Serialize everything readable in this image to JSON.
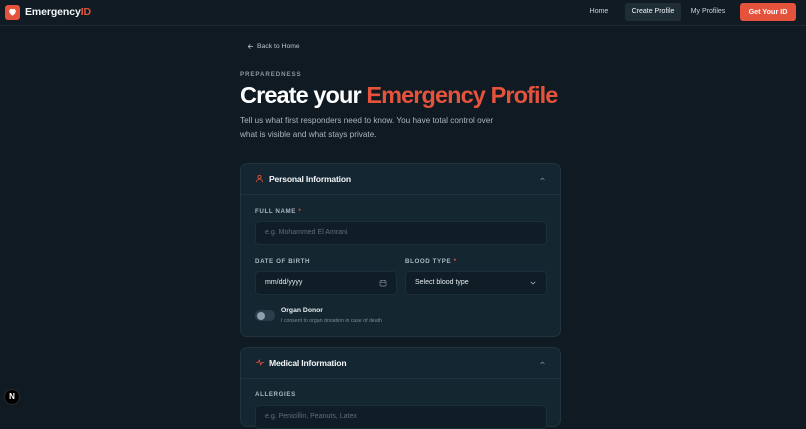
{
  "brand": {
    "name_prefix": "Emergency",
    "name_suffix": "ID"
  },
  "nav": {
    "home": "Home",
    "create_profile": "Create Profile",
    "my_profiles": "My Profiles",
    "cta": "Get Your ID"
  },
  "back_link": "Back to Home",
  "page": {
    "eyebrow": "PREPAREDNESS",
    "title_prefix": "Create your ",
    "title_accent": "Emergency Profile",
    "subtitle": "Tell us what first responders need to know. You have total control over what is visible and what stays private."
  },
  "personal": {
    "title": "Personal Information",
    "full_name_label": "FULL NAME",
    "full_name_placeholder": "e.g. Mohammed El Amrani",
    "dob_label": "DATE OF BIRTH",
    "dob_value": "mm/dd/yyyy",
    "blood_label": "BLOOD TYPE",
    "blood_value": "Select blood type",
    "required_mark": "*",
    "donor_title": "Organ Donor",
    "donor_desc": "I consent to organ donation in case of death",
    "donor_enabled": false
  },
  "medical": {
    "title": "Medical Information",
    "allergies_label": "ALLERGIES",
    "allergies_placeholder": "e.g. Penicillin, Peanuts, Latex"
  },
  "dev_badge": "N",
  "colors": {
    "accent": "#e5533d",
    "background": "#0f1a22",
    "card": "#142630"
  }
}
